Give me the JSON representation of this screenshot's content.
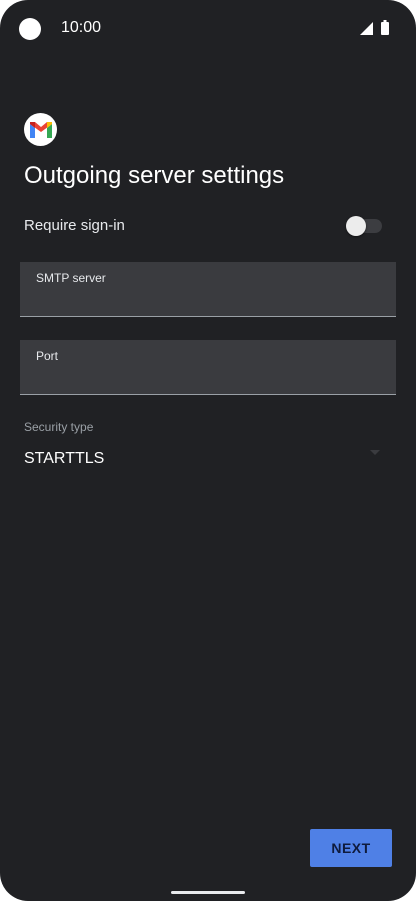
{
  "status_bar": {
    "time": "10:00",
    "icons": [
      "camera-cutout",
      "signal-icon",
      "battery-icon"
    ]
  },
  "app": {
    "logo_icon": "gmail-logo-icon"
  },
  "page": {
    "title": "Outgoing server settings"
  },
  "require_signin": {
    "label": "Require sign-in",
    "enabled": false
  },
  "fields": {
    "smtp_server": {
      "label": "SMTP server",
      "value": ""
    },
    "port": {
      "label": "Port",
      "value": ""
    }
  },
  "security": {
    "label": "Security type",
    "selected": "STARTTLS"
  },
  "actions": {
    "next_label": "NEXT"
  },
  "colors": {
    "background": "#202124",
    "field_bg": "#3a3b3f",
    "accent": "#4f80e6",
    "text": "#ffffff"
  }
}
